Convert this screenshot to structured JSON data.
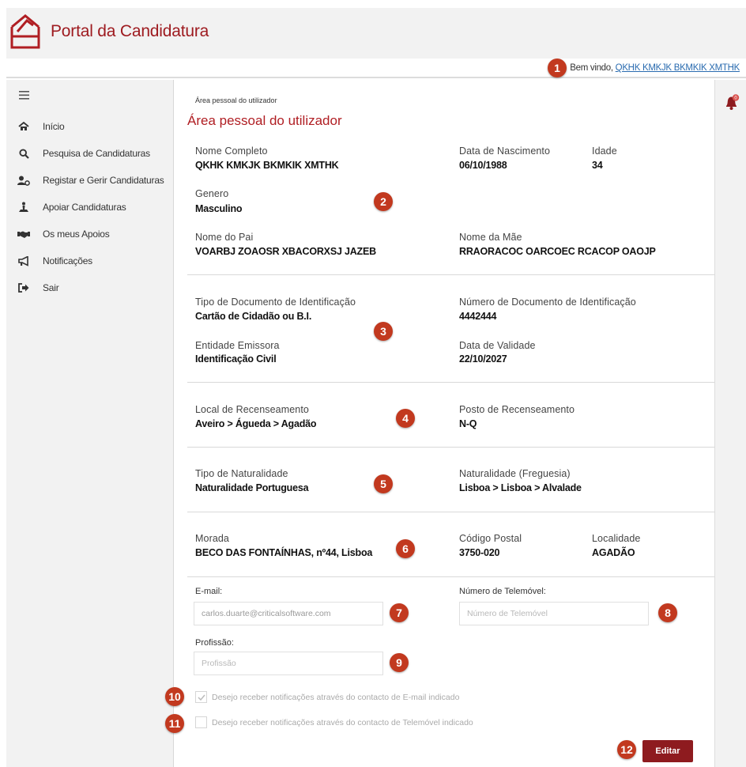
{
  "header": {
    "brand": "Portal da Candidatura",
    "welcome_prefix": "Bem vindo,",
    "user_link": "QKHK KMKJK BKMKIK XMTHK",
    "brand_color": "#9e1b20",
    "logo_icon": "ballot-box-icon"
  },
  "sidebar": {
    "toggle_icon": "hamburger-icon",
    "items": [
      {
        "label": "Início",
        "icon": "home-icon"
      },
      {
        "label": "Pesquisa de Candidaturas",
        "icon": "search-icon"
      },
      {
        "label": "Registar e Gerir Candidaturas",
        "icon": "user-gear-icon"
      },
      {
        "label": "Apoiar Candidaturas",
        "icon": "person-vote-icon"
      },
      {
        "label": "Os meus Apoios",
        "icon": "handshake-icon"
      },
      {
        "label": "Notificações",
        "icon": "megaphone-icon"
      },
      {
        "label": "Sair",
        "icon": "sign-out-icon"
      }
    ]
  },
  "rightbar": {
    "bell_icon": "bell-icon",
    "bell_badge": "0"
  },
  "page": {
    "breadcrumb": "Área pessoal do utilizador",
    "title": "Área pessoal do utilizador"
  },
  "personal": {
    "nome_completo": {
      "label": "Nome Completo",
      "value": "QKHK KMKJK BKMKIK XMTHK"
    },
    "data_nascimento": {
      "label": "Data de Nascimento",
      "value": "06/10/1988"
    },
    "idade": {
      "label": "Idade",
      "value": "34"
    },
    "genero": {
      "label": "Genero",
      "value": "Masculino"
    },
    "nome_pai": {
      "label": "Nome do Pai",
      "value": "VOARBJ ZOAOSR XBACORXSJ JAZEB"
    },
    "nome_mae": {
      "label": "Nome da Mãe",
      "value": "RRAORACOC OARCOEC RCACOP OAOJP"
    }
  },
  "document": {
    "tipo": {
      "label": "Tipo de Documento de Identificação",
      "value": "Cartão de Cidadão ou B.I."
    },
    "numero": {
      "label": "Número de Documento de Identificação",
      "value": "4442444"
    },
    "entidade": {
      "label": "Entidade Emissora",
      "value": "Identificação Civil"
    },
    "validade": {
      "label": "Data de Validade",
      "value": "22/10/2027"
    }
  },
  "census": {
    "local": {
      "label": "Local de Recenseamento",
      "value": "Aveiro > Águeda > Agadão"
    },
    "posto": {
      "label": "Posto de Recenseamento",
      "value": "N-Q"
    }
  },
  "birthplace": {
    "tipo": {
      "label": "Tipo de Naturalidade",
      "value": "Naturalidade Portuguesa"
    },
    "freguesia": {
      "label": "Naturalidade (Freguesia)",
      "value": "Lisboa > Lisboa > Alvalade"
    }
  },
  "address": {
    "morada": {
      "label": "Morada",
      "value": "BECO DAS FONTAÍNHAS, nº44, Lisboa"
    },
    "codigo_postal": {
      "label": "Código Postal",
      "value": "3750-020"
    },
    "localidade": {
      "label": "Localidade",
      "value": "AGADÃO"
    }
  },
  "contact": {
    "email_label": "E-mail:",
    "email_value": "carlos.duarte@criticalsoftware.com",
    "phone_label": "Número de Telemóvel:",
    "phone_placeholder": "Número de Telemóvel",
    "job_label": "Profissão:",
    "job_placeholder": "Profissão",
    "notify_email": {
      "label": "Desejo receber notificações através do contacto de E-mail indicado",
      "checked": true
    },
    "notify_phone": {
      "label": "Desejo receber notificações através do contacto de Telemóvel indicado",
      "checked": false
    }
  },
  "actions": {
    "edit_label": "Editar"
  },
  "markers": [
    "1",
    "2",
    "3",
    "4",
    "5",
    "6",
    "7",
    "8",
    "9",
    "10",
    "11",
    "12"
  ],
  "colors": {
    "accent": "#b01e23",
    "button": "#8e1b1f",
    "marker": "#c2391f",
    "link": "#2b6cb0"
  }
}
